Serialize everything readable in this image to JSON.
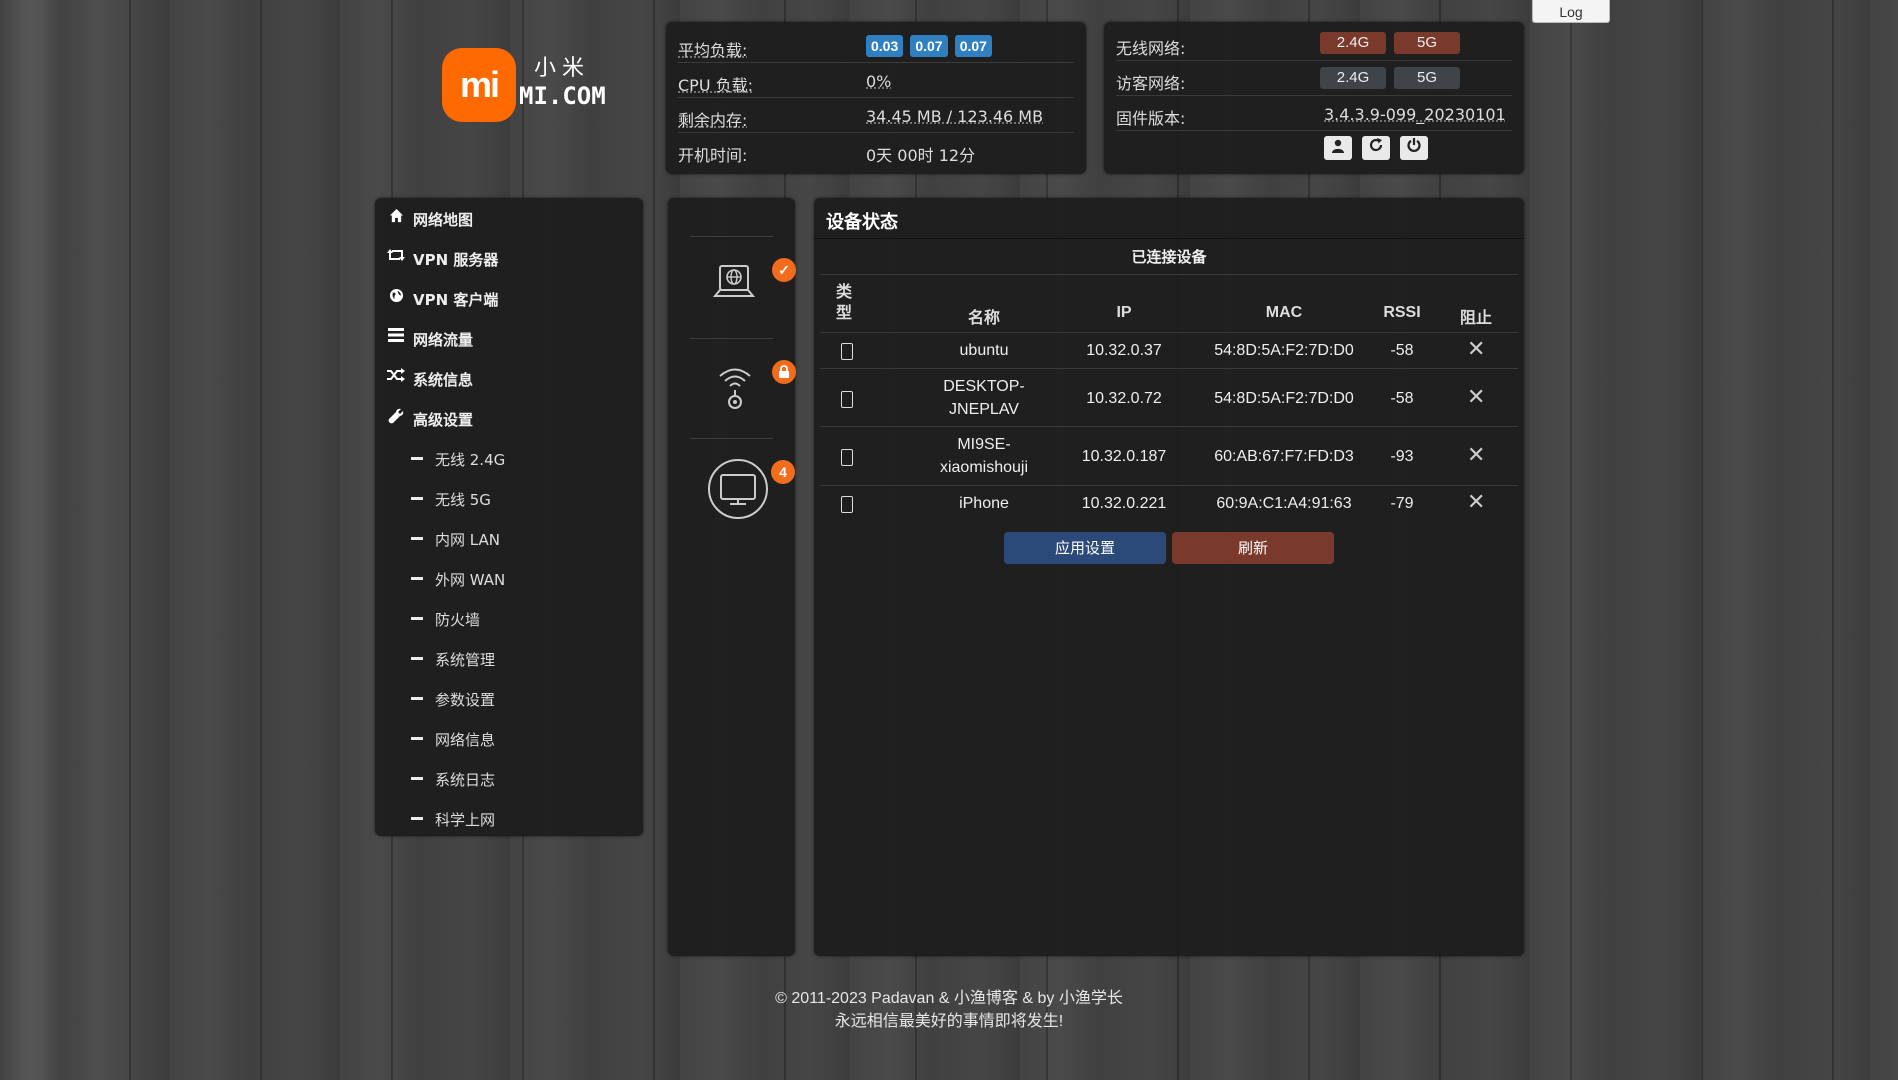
{
  "logo": {
    "badge": "mi",
    "cn": "小米",
    "en": "MI.COM"
  },
  "log_button": "Log",
  "system": {
    "rows": [
      {
        "label": "平均负载:",
        "badges": [
          "0.03",
          "0.07",
          "0.07"
        ]
      },
      {
        "label": "CPU 负载:",
        "value": "0%"
      },
      {
        "label": "剩余内存:",
        "value": "34.45 MB / 123.46 MB"
      },
      {
        "label": "开机时间:",
        "value": "0天 00时 12分"
      }
    ]
  },
  "network": {
    "wireless_label": "无线网络:",
    "guest_label": "访客网络:",
    "firmware_label": "固件版本:",
    "firmware_value": "3.4.3.9-099_20230101",
    "wireless_bands": [
      "2.4G",
      "5G"
    ],
    "guest_bands": [
      "2.4G",
      "5G"
    ],
    "action_icons": [
      "user-icon",
      "refresh-icon",
      "power-icon"
    ]
  },
  "sidebar": {
    "items": [
      {
        "label": "网络地图",
        "icon": "home-icon"
      },
      {
        "label": "VPN 服务器",
        "icon": "retweet-icon"
      },
      {
        "label": "VPN 客户端",
        "icon": "globe-icon"
      },
      {
        "label": "网络流量",
        "icon": "tasks-icon"
      },
      {
        "label": "系统信息",
        "icon": "random-icon"
      },
      {
        "label": "高级设置",
        "icon": "wrench-icon"
      }
    ],
    "sub_items": [
      "无线 2.4G",
      "无线 5G",
      "内网 LAN",
      "外网 WAN",
      "防火墙",
      "系统管理",
      "参数设置",
      "网络信息",
      "系统日志",
      "科学上网"
    ]
  },
  "status_icons": {
    "internet_badge": "✓",
    "wifi_badge": "lock",
    "clients_count": "4"
  },
  "device_status": {
    "title": "设备状态",
    "subtitle": "已连接设备",
    "headers": {
      "type": "类\n型",
      "name": "名称",
      "ip": "IP",
      "mac": "MAC",
      "rssi": "RSSI",
      "block": "阻止"
    },
    "devices": [
      {
        "name": "ubuntu",
        "ip": "10.32.0.37",
        "mac": "54:8D:5A:F2:7D:D0",
        "rssi": "-58"
      },
      {
        "name": "DESKTOP-\nJNEPLAV",
        "ip": "10.32.0.72",
        "mac": "54:8D:5A:F2:7D:D0",
        "rssi": "-58"
      },
      {
        "name": "MI9SE-\nxiaomishouji",
        "ip": "10.32.0.187",
        "mac": "60:AB:67:F7:FD:D3",
        "rssi": "-93"
      },
      {
        "name": "iPhone",
        "ip": "10.32.0.221",
        "mac": "60:9A:C1:A4:91:63",
        "rssi": "-79"
      }
    ],
    "apply_button": "应用设置",
    "refresh_button": "刷新"
  },
  "footer": {
    "line1": "© 2011-2023 Padavan & 小渔博客 & by 小渔学长",
    "line2": "永远相信最美好的事情即将发生!"
  },
  "colors": {
    "accent_orange": "#f26c1c",
    "badge_blue": "#2f7fc1",
    "apply_blue": "#2b4a7a",
    "refresh_red": "#7a3a2b"
  }
}
